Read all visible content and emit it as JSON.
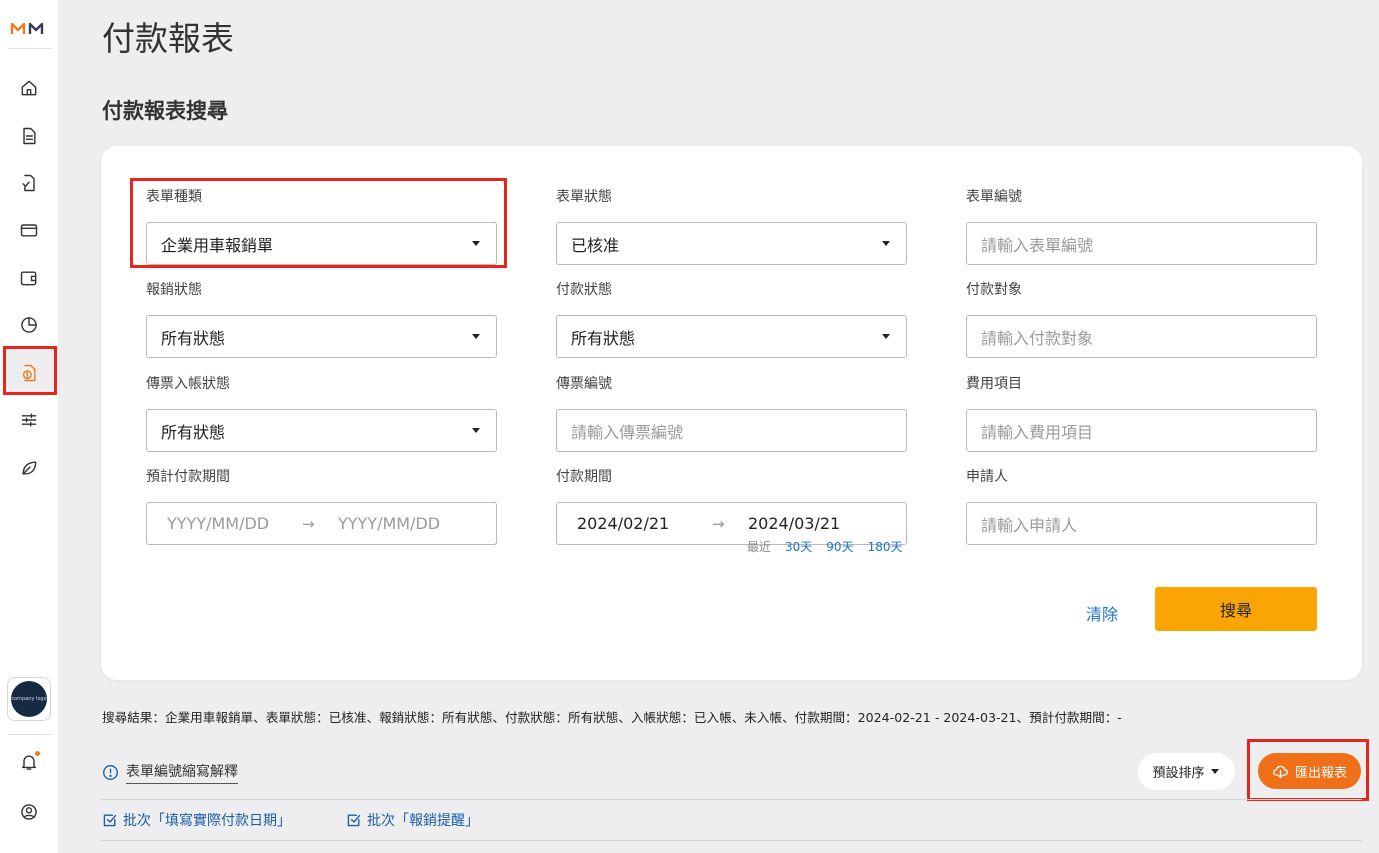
{
  "page": {
    "title": "付款報表",
    "section_title": "付款報表搜尋"
  },
  "sidebar": {
    "logo": "mm-logo-icon",
    "items": [
      "home-icon",
      "document-icon",
      "document-check-icon",
      "card-icon",
      "wallet-icon",
      "pie-chart-icon",
      "payment-report-icon",
      "sliders-icon",
      "leaf-icon"
    ],
    "active_item": "payment-report-icon",
    "bottom": [
      "bell-icon",
      "user-circle-icon"
    ]
  },
  "form": {
    "form_type": {
      "label": "表單種類",
      "value": "企業用車報銷單"
    },
    "form_status": {
      "label": "表單狀態",
      "value": "已核准"
    },
    "form_number": {
      "label": "表單編號",
      "placeholder": "請輸入表單編號"
    },
    "reimburse_status": {
      "label": "報銷狀態",
      "value": "所有狀態"
    },
    "payment_status": {
      "label": "付款狀態",
      "value": "所有狀態"
    },
    "payee": {
      "label": "付款對象",
      "placeholder": "請輸入付款對象"
    },
    "voucher_status": {
      "label": "傳票入帳狀態",
      "value": "所有狀態"
    },
    "voucher_number": {
      "label": "傳票編號",
      "placeholder": "請輸入傳票編號"
    },
    "expense_item": {
      "label": "費用項目",
      "placeholder": "請輸入費用項目"
    },
    "expected_period": {
      "label": "預計付款期間",
      "start_placeholder": "YYYY/MM/DD",
      "end_placeholder": "YYYY/MM/DD"
    },
    "payment_period": {
      "label": "付款期間",
      "start": "2024/02/21",
      "end": "2024/03/21"
    },
    "applicant": {
      "label": "申請人",
      "placeholder": "請輸入申請人"
    },
    "quick_ranges": {
      "label": "最近",
      "options": [
        "30天",
        "90天",
        "180天"
      ]
    },
    "clear_label": "清除",
    "search_label": "搜尋"
  },
  "summary": "搜尋結果：企業用車報銷單、表單狀態：已核准、報銷狀態：所有狀態、付款狀態：所有狀態、入帳狀態：已入帳、未入帳、付款期間：2024-02-21 - 2024-03-21、預計付款期間：-",
  "toolbar": {
    "explain_label": "表單編號縮寫解釋",
    "sort_label": "預設排序",
    "export_label": "匯出報表",
    "batch_payment_date": "批次「填寫實際付款日期」",
    "batch_reminder": "批次「報銷提醒」"
  },
  "avatar_text": "company logo",
  "colors": {
    "accent": "#f07019",
    "search_button": "#fba505",
    "link": "#1a73c8",
    "highlight": "#e8251b"
  }
}
